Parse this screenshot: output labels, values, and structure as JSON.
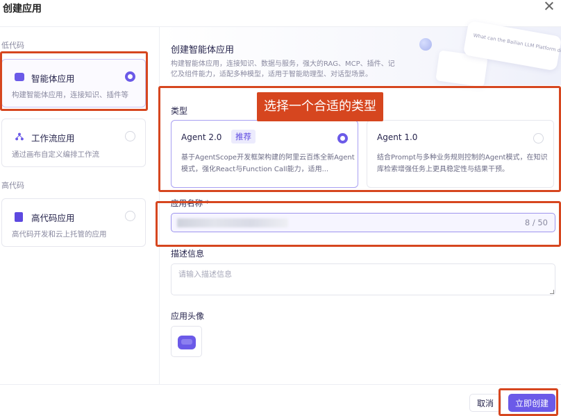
{
  "dialog": {
    "title": "创建应用"
  },
  "sidebar": {
    "groups": [
      {
        "label": "低代码"
      },
      {
        "label": "高代码"
      }
    ],
    "items": [
      {
        "name": "智能体应用",
        "desc": "构建智能体应用，连接知识、插件等",
        "selected": true,
        "icon": "robot-icon"
      },
      {
        "name": "工作流应用",
        "desc": "通过画布自定义编排工作流",
        "selected": false,
        "icon": "workflow-icon"
      },
      {
        "name": "高代码应用",
        "desc": "高代码开发和云上托管的应用",
        "selected": false,
        "icon": "document-icon"
      }
    ]
  },
  "banner": {
    "title": "创建智能体应用",
    "desc": "构建智能体应用，连接知识、数据与服务，强大的RAG、MCP、插件、记忆及组件能力，适配多种模型，适用于智能助理型、对话型场景。",
    "chip_text": "What can the Bailian LLM Platform do?"
  },
  "type_section": {
    "label": "类型",
    "cards": [
      {
        "name": "Agent 2.0",
        "badge": "推荐",
        "desc": "基于AgentScope开发框架构建的阿里云百炼全新Agent模式，强化React与Function Call能力，适用...",
        "selected": true
      },
      {
        "name": "Agent 1.0",
        "badge": "",
        "desc": "结合Prompt与多种业务规则控制的Agent模式，在知识库检索增强任务上更具稳定性与结果干预。",
        "selected": false
      }
    ]
  },
  "app_name": {
    "label": "应用名称 *",
    "counter": "8 / 50"
  },
  "description": {
    "label": "描述信息",
    "placeholder": "请输入描述信息"
  },
  "avatar": {
    "label": "应用头像"
  },
  "footer": {
    "cancel": "取消",
    "create": "立即创建"
  },
  "annotation": {
    "callout": "选择一个合适的类型",
    "color": "#d6461f"
  },
  "colors": {
    "accent": "#6b5ae8",
    "annotation": "#d6461f"
  }
}
